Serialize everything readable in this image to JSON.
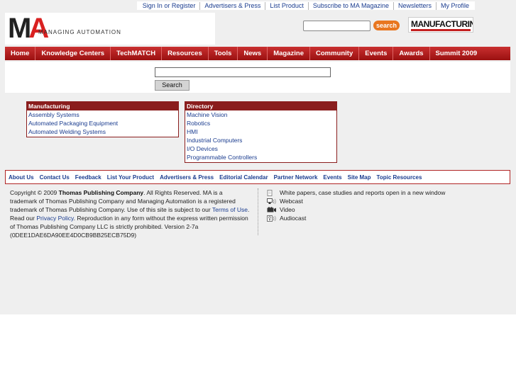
{
  "top_links": [
    "Sign In or Register",
    "Advertisers & Press",
    "List Product",
    "Subscribe to MA Magazine",
    "Newsletters",
    "My Profile"
  ],
  "logo": {
    "mark_m": "M",
    "mark_a": "A",
    "text": "MANAGING AUTOMATION"
  },
  "header_search": {
    "button_label": "search",
    "placeholder": ""
  },
  "mfg_badge": "MANUFACTURING",
  "nav": [
    "Home",
    "Knowledge Centers",
    "TechMATCH",
    "Resources",
    "Tools",
    "News",
    "Magazine",
    "Community",
    "Events",
    "Awards",
    "Summit 2009"
  ],
  "main_search": {
    "button_label": "Search",
    "value": ""
  },
  "manufacturing": {
    "title": "Manufacturing",
    "items": [
      "Assembly Systems",
      "Automated Packaging Equipment",
      "Automated Welding Systems"
    ]
  },
  "directory": {
    "title": "Directory",
    "items": [
      "Machine Vision",
      "Robotics",
      "HMI",
      "Industrial Computers",
      "I/O Devices",
      "Programmable Controllers"
    ]
  },
  "footer_nav": [
    "About Us",
    "Contact Us",
    "Feedback",
    "List Your Product",
    "Advertisers & Press",
    "Editorial Calendar",
    "Partner Network",
    "Events",
    "Site Map",
    "Topic Resources"
  ],
  "copyright": {
    "prefix": "Copyright © 2009 ",
    "company": "Thomas Publishing Company",
    "middle": ". All Rights Reserved. MA is a trademark of Thomas Publishing Company and Managing Automation is a registered trademark of Thomas Publishing Company. Use of this site is subject to our ",
    "terms_link": "Terms of Use",
    "middle2": ". Read our ",
    "privacy_link": "Privacy Policy",
    "suffix": ". Reproduction in any form without the express written permission of Thomas Publishing Company LLC is strictly prohibited. Version 2-7a (0DEE1DAE6DA90EE4D0CB9BB25ECB75D9)"
  },
  "legend": [
    {
      "icon": "document-icon",
      "label": "White papers, case studies and reports open in a new window"
    },
    {
      "icon": "webcast-icon",
      "label": "Webcast"
    },
    {
      "icon": "video-icon",
      "label": "Video"
    },
    {
      "icon": "audiocast-icon",
      "label": "Audiocast"
    }
  ],
  "colors": {
    "nav_red": "#b01c1c",
    "link_blue": "#1a3c8f",
    "search_orange": "#e8761f"
  }
}
